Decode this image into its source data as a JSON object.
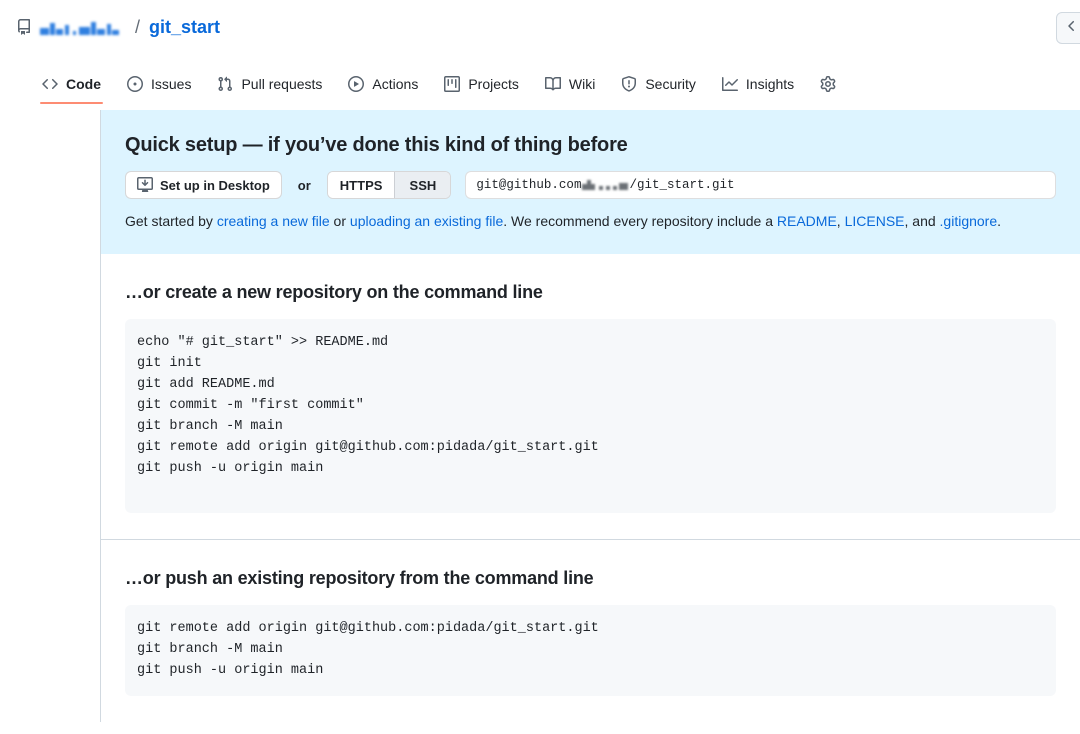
{
  "header": {
    "repo_icon": "repo-icon",
    "owner_label": "",
    "separator": "/",
    "repo_name": "git_start",
    "corner_button_icon": "chevron-left-icon"
  },
  "tabs": [
    {
      "label": "Code",
      "icon": "code-icon",
      "active": true
    },
    {
      "label": "Issues",
      "icon": "issue-opened-icon",
      "active": false
    },
    {
      "label": "Pull requests",
      "icon": "git-pull-request-icon",
      "active": false
    },
    {
      "label": "Actions",
      "icon": "play-icon",
      "active": false
    },
    {
      "label": "Projects",
      "icon": "project-icon",
      "active": false
    },
    {
      "label": "Wiki",
      "icon": "book-icon",
      "active": false
    },
    {
      "label": "Security",
      "icon": "shield-icon",
      "active": false
    },
    {
      "label": "Insights",
      "icon": "graph-icon",
      "active": false
    }
  ],
  "quick_setup": {
    "heading": "Quick setup — if you’ve done this kind of thing before",
    "desktop_button": "Set up in Desktop",
    "or_label": "or",
    "protocols": [
      {
        "label": "HTTPS",
        "selected": false
      },
      {
        "label": "SSH",
        "selected": true
      }
    ],
    "clone_url_prefix": "git@github.com",
    "clone_url_suffix": "/git_start.git",
    "get_started": {
      "prefix": "Get started by ",
      "link_new_file": "creating a new file",
      "mid1": " or ",
      "link_upload": "uploading an existing file",
      "mid2": ". We recommend every repository include a ",
      "link_readme": "README",
      "comma1": ", ",
      "link_license": "LICENSE",
      "mid3": ", and ",
      "link_gitignore": ".gitignore",
      "suffix": "."
    }
  },
  "cli_sections": [
    {
      "heading": "…or create a new repository on the command line",
      "code": "echo \"# git_start\" >> README.md\ngit init\ngit add README.md\ngit commit -m \"first commit\"\ngit branch -M main\ngit remote add origin git@github.com:pidada/git_start.git\ngit push -u origin main"
    },
    {
      "heading": "…or push an existing repository from the command line",
      "code": "git remote add origin git@github.com:pidada/git_start.git\ngit branch -M main\ngit push -u origin main"
    }
  ],
  "colors": {
    "link": "#0969da",
    "active_tab_underline": "#fd8c73",
    "quick_setup_bg": "#ddf4ff",
    "code_bg": "#f6f8fa",
    "border": "#d1d9e0"
  }
}
